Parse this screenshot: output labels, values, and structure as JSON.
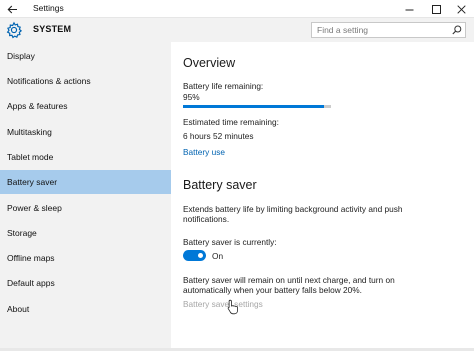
{
  "window": {
    "title": "Settings",
    "controls": [
      "minimize",
      "maximize",
      "close"
    ]
  },
  "header": {
    "section_title": "SYSTEM",
    "search_placeholder": "Find a setting",
    "search_value": ""
  },
  "sidebar": {
    "items": [
      {
        "label": "Display",
        "active": false
      },
      {
        "label": "Notifications & actions",
        "active": false
      },
      {
        "label": "Apps & features",
        "active": false
      },
      {
        "label": "Multitasking",
        "active": false
      },
      {
        "label": "Tablet mode",
        "active": false
      },
      {
        "label": "Battery saver",
        "active": true
      },
      {
        "label": "Power & sleep",
        "active": false
      },
      {
        "label": "Storage",
        "active": false
      },
      {
        "label": "Offline maps",
        "active": false
      },
      {
        "label": "Default apps",
        "active": false
      },
      {
        "label": "About",
        "active": false
      }
    ]
  },
  "overview": {
    "heading": "Overview",
    "battery_label": "Battery life remaining:",
    "battery_value": "95%",
    "battery_fraction": 0.95,
    "time_label": "Estimated time remaining:",
    "time_value": "6 hours 52 minutes",
    "usage_link": "Battery use"
  },
  "battery_saver": {
    "heading": "Battery saver",
    "description_line1": "Extends battery life by limiting background activity and push",
    "description_line2": "notifications.",
    "status_label": "Battery saver is currently:",
    "toggle_state": "On",
    "toggle_on": true,
    "remain_line1": "Battery saver will remain on until next charge, and turn on",
    "remain_line2": "automatically when your battery falls below 20%.",
    "settings_link": "Battery saver settings"
  },
  "colors": {
    "accent": "#0078d7",
    "active_nav": "#a6cbec",
    "sidebar_bg": "#f2f2f2",
    "link": "#0063b1",
    "disabled_text": "#a6a6a6"
  },
  "icons": [
    "back-arrow-icon",
    "minimize-icon",
    "maximize-icon",
    "close-icon",
    "gear-icon",
    "search-icon",
    "mouse-pointer-icon"
  ]
}
